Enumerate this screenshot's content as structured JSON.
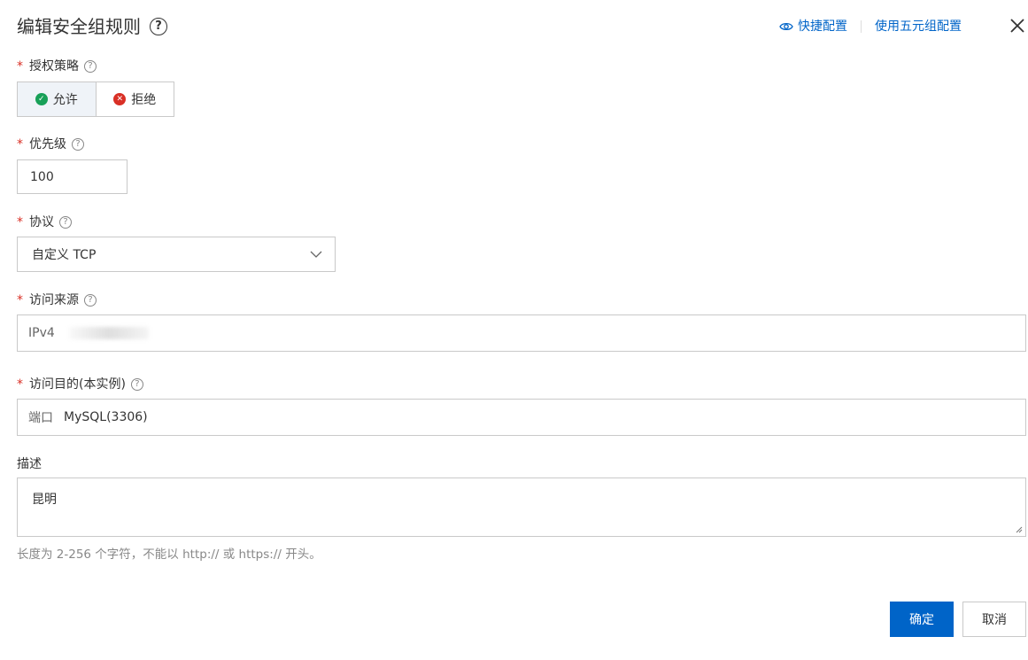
{
  "dialog": {
    "title": "编辑安全组规则",
    "help_glyph": "?",
    "quick_config_label": "快捷配置",
    "five_tuple_label": "使用五元组配置"
  },
  "form": {
    "policy": {
      "label": "授权策略",
      "options": [
        {
          "label": "允许",
          "selected": true
        },
        {
          "label": "拒绝",
          "selected": false
        }
      ]
    },
    "priority": {
      "label": "优先级",
      "value": "100"
    },
    "protocol": {
      "label": "协议",
      "value": "自定义 TCP"
    },
    "source": {
      "label": "访问来源",
      "prefix": "IPv4"
    },
    "destination": {
      "label": "访问目的(本实例)",
      "prefix": "端口",
      "value": "MySQL(3306)"
    },
    "description": {
      "label": "描述",
      "value": "昆明",
      "hint": "长度为 2-256 个字符，不能以 http:// 或 https:// 开头。"
    }
  },
  "footer": {
    "confirm_label": "确定",
    "cancel_label": "取消"
  },
  "colors": {
    "primary": "#0064c8",
    "required": "#d93026",
    "allow": "#18a058",
    "deny": "#d93026"
  }
}
